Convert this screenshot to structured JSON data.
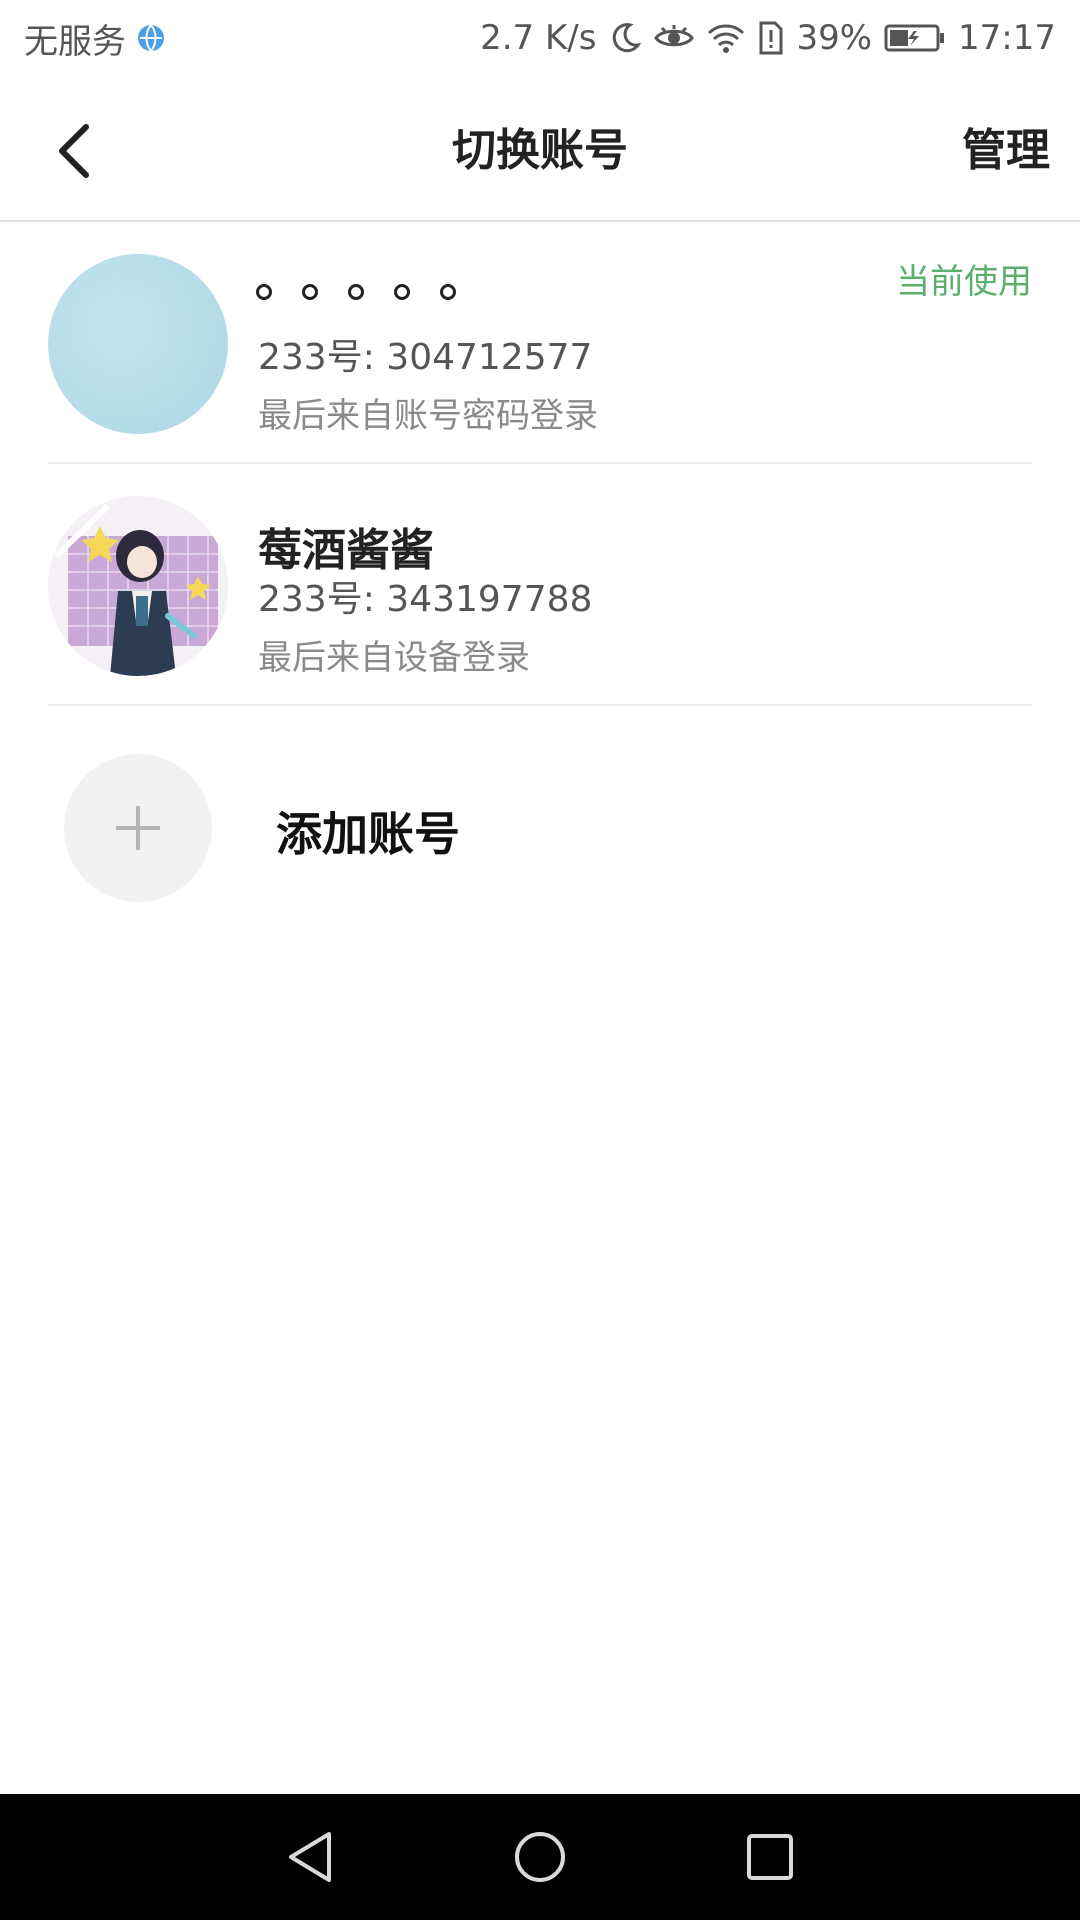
{
  "status_bar": {
    "carrier": "无服务",
    "speed": "2.7 K/s",
    "battery": "39%",
    "time": "17:17"
  },
  "header": {
    "title": "切换账号",
    "manage_label": "管理"
  },
  "accounts": [
    {
      "name": "。。。。。",
      "id_text": "233号: 304712577",
      "subtitle": "最后来自账号密码登录",
      "badge": "当前使用"
    },
    {
      "name": "莓酒酱酱",
      "id_text": "233号: 343197788",
      "subtitle": "最后来自设备登录"
    }
  ],
  "add_account": {
    "label": "添加账号"
  },
  "colors": {
    "accent_green": "#5cae6d",
    "divider": "#ececec",
    "nav_background": "#000000"
  },
  "icons": [
    "back-chevron-icon",
    "globe-icon",
    "moon-icon",
    "eye-icon",
    "wifi-icon",
    "sim-alert-icon",
    "battery-icon",
    "plus-icon",
    "nav-back-icon",
    "nav-home-icon",
    "nav-recents-icon"
  ]
}
